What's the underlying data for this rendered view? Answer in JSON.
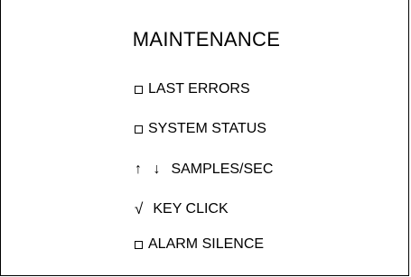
{
  "menu": {
    "title": "MAINTENANCE",
    "items": [
      {
        "label": "LAST ERRORS",
        "indicator": "checkbox-empty"
      },
      {
        "label": "SYSTEM STATUS",
        "indicator": "checkbox-empty"
      },
      {
        "label": "SAMPLES/SEC",
        "indicator": "up-down-arrows",
        "indicator_text": "↑ ↓"
      },
      {
        "label": "KEY CLICK",
        "indicator": "checkmark",
        "indicator_text": "√"
      },
      {
        "label": "ALARM SILENCE",
        "indicator": "checkbox-empty"
      }
    ]
  },
  "colors": {
    "background": "#ffffff",
    "foreground": "#000000"
  }
}
